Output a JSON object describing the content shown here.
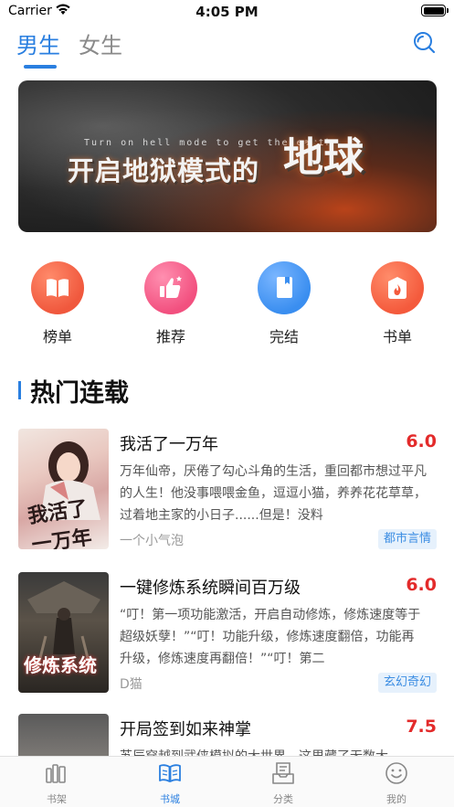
{
  "status_bar": {
    "carrier": "Carrier",
    "time": "4:05 PM"
  },
  "top_tabs": [
    {
      "label": "男生",
      "active": true
    },
    {
      "label": "女生",
      "active": false
    }
  ],
  "banner": {
    "subtitle": "Turn on hell mode to get the earth",
    "title": "开启地狱模式的",
    "title_big": "地球"
  },
  "quick_nav": [
    {
      "label": "榜单",
      "icon": "book-open-icon",
      "color": "#f0583d"
    },
    {
      "label": "推荐",
      "icon": "thumbs-up-icon",
      "color": "#f2507f"
    },
    {
      "label": "完结",
      "icon": "book-closed-icon",
      "color": "#3a8ef0"
    },
    {
      "label": "书单",
      "icon": "fire-bag-icon",
      "color": "#f45a3c"
    }
  ],
  "section": {
    "title": "热门连载"
  },
  "books": [
    {
      "title": "我活了一万年",
      "score": "6.0",
      "description": "万年仙帝，厌倦了勾心斗角的生活，重回都市想过平凡的人生！他没事喂喂金鱼，逗逗小猫，养养花花草草，过着地主家的小日子......但是！没料",
      "author": "一个小气泡",
      "tag": "都市言情",
      "cover_text": "我活了一万年"
    },
    {
      "title": "一键修炼系统瞬间百万级",
      "score": "6.0",
      "description": "“叮！第一项功能激活，开启自动修炼，修炼速度等于超级妖孽！”“叮！功能升级，修炼速度翻倍，功能再升级，修炼速度再翻倍！”“叮！第二",
      "author": "D猫",
      "tag": "玄幻奇幻",
      "cover_text": "修炼系统"
    },
    {
      "title": "开局签到如来神掌",
      "score": "7.5",
      "description": "苏辰穿越到武侠模拟的大世界，这里藏了无数大",
      "author": "",
      "tag": ""
    }
  ],
  "tab_bar": [
    {
      "label": "书架",
      "icon": "bookshelf-icon",
      "active": false
    },
    {
      "label": "书城",
      "icon": "open-book-icon",
      "active": true
    },
    {
      "label": "分类",
      "icon": "category-icon",
      "active": false
    },
    {
      "label": "我的",
      "icon": "smiley-icon",
      "active": false
    }
  ],
  "colors": {
    "accent": "#2a7fe0",
    "score": "#e32b2b",
    "tag_bg": "#e6f1fc",
    "tag_text": "#3d8ee3"
  }
}
